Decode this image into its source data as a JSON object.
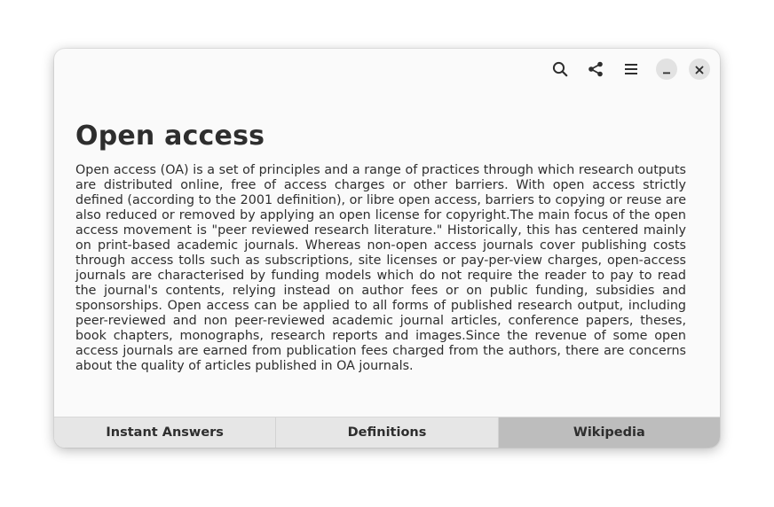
{
  "header": {
    "icons": {
      "search": "search-icon",
      "share": "share-icon",
      "menu": "hamburger-menu-icon",
      "minimize": "minimize-icon",
      "close": "close-icon"
    }
  },
  "article": {
    "title": "Open access",
    "body": "Open access (OA) is a set of principles and a range of practices through which research outputs are distributed online, free of access charges or other barriers. With open access strictly defined (according to the 2001 definition), or libre open access, barriers to copying or reuse are also reduced or removed by applying an open license for copyright.The main focus of the open access movement is \"peer reviewed research literature.\" Historically, this has centered mainly on print-based academic journals. Whereas non-open access journals cover publishing costs through access tolls such as subscriptions, site licenses or pay-per-view charges, open-access journals are characterised by funding models which do not require the reader to pay to read the journal's contents, relying instead on author fees or on public funding, subsidies and sponsorships. Open access can be applied to all forms of published research output, including peer-reviewed and non peer-reviewed academic journal articles, conference papers, theses, book chapters, monographs, research reports and images.Since the revenue of some open access journals are earned from publication fees charged from the authors, there are concerns about the quality of articles published in OA journals."
  },
  "tabs": [
    {
      "label": "Instant Answers",
      "active": false
    },
    {
      "label": "Definitions",
      "active": false
    },
    {
      "label": "Wikipedia",
      "active": true
    }
  ],
  "colors": {
    "window_bg": "#fafafa",
    "text": "#2e2e2e",
    "tab_bg": "#e6e6e6",
    "tab_active_bg": "#bdbdbd",
    "window_button_bg": "#e2e2e2"
  }
}
